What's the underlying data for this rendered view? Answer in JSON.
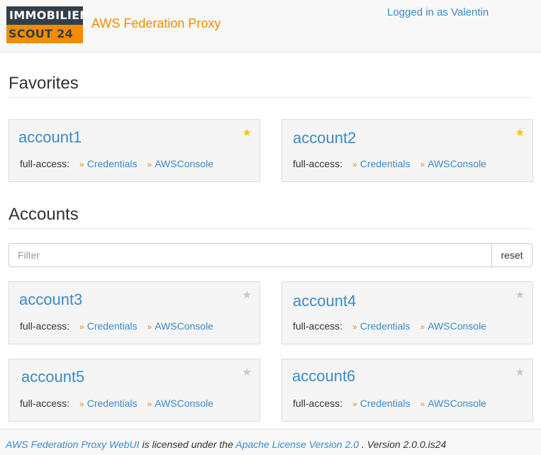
{
  "header": {
    "logo_top": "IMMOBILIEN",
    "logo_bottom": "SCOUT 24",
    "title": "AWS Federation Proxy",
    "user": "Logged in as Valentin"
  },
  "favorites": {
    "heading": "Favorites",
    "cards": [
      {
        "name": "account1",
        "role": "full-access:",
        "credentials": "Credentials",
        "console": "AWSConsole",
        "star": "★",
        "favorite": true
      },
      {
        "name": "account2",
        "role": "full-access:",
        "credentials": "Credentials",
        "console": "AWSConsole",
        "star": "★",
        "favorite": true
      }
    ]
  },
  "accounts": {
    "heading": "Accounts",
    "filter_placeholder": "Filter",
    "reset_label": "reset",
    "cards": [
      {
        "name": "account3",
        "role": "full-access:",
        "credentials": "Credentials",
        "console": "AWSConsole",
        "star": "★",
        "favorite": false
      },
      {
        "name": "account4",
        "role": "full-access:",
        "credentials": "Credentials",
        "console": "AWSConsole",
        "star": "★",
        "favorite": false
      },
      {
        "name": "account5",
        "role": "full-access:",
        "credentials": "Credentials",
        "console": "AWSConsole",
        "star": "★",
        "favorite": false
      },
      {
        "name": "account6",
        "role": "full-access:",
        "credentials": "Credentials",
        "console": "AWSConsole",
        "star": "★",
        "favorite": false
      }
    ]
  },
  "link_marker": "»",
  "footer": {
    "product": "AWS Federation Proxy WebUI",
    "licensed_text": "is licensed under the",
    "license": "Apache License Version 2.0",
    "version": ". Version 2.0.0.is24"
  },
  "colors": {
    "brand_orange": "#f28c00",
    "brand_dark": "#333f48",
    "link_blue": "#3a8bc6",
    "favorite_star": "#f5c600",
    "inactive_star": "#c8c8c8"
  }
}
